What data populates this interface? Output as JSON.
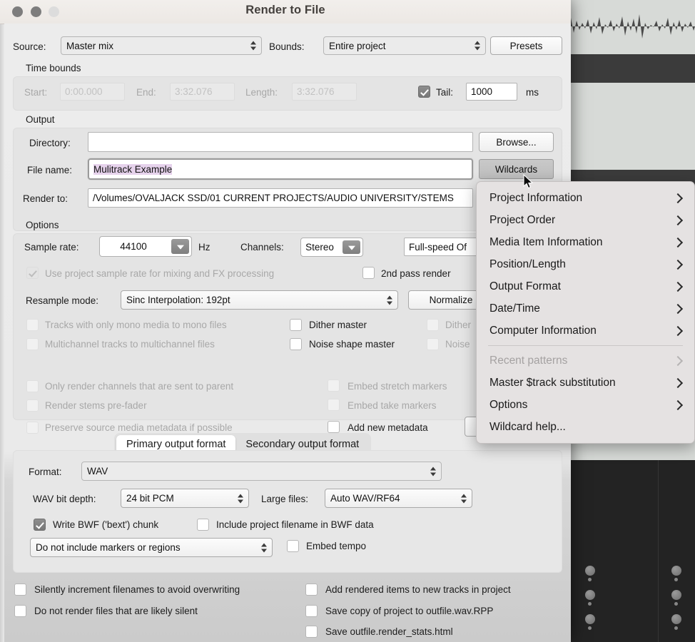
{
  "window": {
    "title": "Render to File",
    "traffic_lights": [
      "close",
      "minimize",
      "maximize"
    ]
  },
  "source_row": {
    "source_label": "Source:",
    "source_value": "Master mix",
    "bounds_label": "Bounds:",
    "bounds_value": "Entire project",
    "presets_button": "Presets"
  },
  "time_bounds": {
    "group_label": "Time bounds",
    "start_label": "Start:",
    "start_value": "0:00.000",
    "end_label": "End:",
    "end_value": "3:32.076",
    "length_label": "Length:",
    "length_value": "3:32.076",
    "tail_label": "Tail:",
    "tail_checked": true,
    "tail_value": "1000",
    "tail_units": "ms"
  },
  "output": {
    "group_label": "Output",
    "directory_label": "Directory:",
    "directory_value": "",
    "browse_button": "Browse...",
    "filename_label": "File name:",
    "filename_value": "Mulitrack Example",
    "wildcards_button": "Wildcards",
    "render_to_label": "Render to:",
    "render_to_value": "/Volumes/OVALJACK SSD/01 CURRENT PROJECTS/AUDIO UNIVERSITY/STEMS"
  },
  "options": {
    "group_label": "Options",
    "sample_rate_label": "Sample rate:",
    "sample_rate_value": "44100",
    "sample_rate_units": "Hz",
    "channels_label": "Channels:",
    "channels_value": "Stereo",
    "speed_value": "Full-speed Of",
    "resample_label": "Resample mode:",
    "resample_value": "Sinc Interpolation: 192pt",
    "normalize_button": "Normalize",
    "checkboxes": [
      {
        "label": "Use project sample rate for mixing and FX processing",
        "checked": true,
        "disabled": true
      },
      {
        "label": "2nd pass render",
        "checked": false,
        "disabled": false
      },
      {
        "label": "Tracks with only mono media to mono files",
        "checked": false,
        "disabled": true
      },
      {
        "label": "Dither master",
        "checked": false,
        "disabled": false
      },
      {
        "label": "Dither",
        "checked": false,
        "disabled": true
      },
      {
        "label": "Multichannel tracks to multichannel files",
        "checked": false,
        "disabled": true
      },
      {
        "label": "Noise shape master",
        "checked": false,
        "disabled": false
      },
      {
        "label": "Noise",
        "checked": false,
        "disabled": true
      },
      {
        "label": "Only render channels that are sent to parent",
        "checked": false,
        "disabled": true
      },
      {
        "label": "Embed stretch markers",
        "checked": false,
        "disabled": true
      },
      {
        "label": "Render stems pre-fader",
        "checked": false,
        "disabled": true
      },
      {
        "label": "Embed take markers",
        "checked": false,
        "disabled": true
      },
      {
        "label": "Preserve source media metadata if possible",
        "checked": false,
        "disabled": true
      },
      {
        "label": "Add new metadata",
        "checked": false,
        "disabled": false
      }
    ]
  },
  "format_tabs": {
    "primary": "Primary output format",
    "secondary": "Secondary output format",
    "active": "Primary output format"
  },
  "format_panel": {
    "format_label": "Format:",
    "format_value": "WAV",
    "bitdepth_label": "WAV bit depth:",
    "bitdepth_value": "24 bit PCM",
    "largefiles_label": "Large files:",
    "largefiles_value": "Auto WAV/RF64",
    "write_bwf_label": "Write BWF ('bext') chunk",
    "write_bwf_checked": true,
    "include_proj_label": "Include project filename in BWF data",
    "include_proj_checked": false,
    "markers_value": "Do not include markers or regions",
    "embed_tempo_label": "Embed tempo",
    "embed_tempo_checked": false
  },
  "footer": {
    "left": [
      {
        "label": "Silently increment filenames to avoid overwriting",
        "checked": false
      },
      {
        "label": "Do not render files that are likely silent",
        "checked": false
      }
    ],
    "right": [
      {
        "label": "Add rendered items to new tracks in project",
        "checked": false
      },
      {
        "label": "Save copy of project to outfile.wav.RPP",
        "checked": false
      },
      {
        "label": "Save outfile.render_stats.html",
        "checked": false
      }
    ]
  },
  "wildcard_menu": {
    "items": [
      {
        "label": "Project Information",
        "submenu": true,
        "disabled": false
      },
      {
        "label": "Project Order",
        "submenu": true,
        "disabled": false
      },
      {
        "label": "Media Item Information",
        "submenu": true,
        "disabled": false
      },
      {
        "label": "Position/Length",
        "submenu": true,
        "disabled": false
      },
      {
        "label": "Output Format",
        "submenu": true,
        "disabled": false
      },
      {
        "label": "Date/Time",
        "submenu": true,
        "disabled": false
      },
      {
        "label": "Computer Information",
        "submenu": true,
        "disabled": false
      },
      {
        "label": "Recent patterns",
        "submenu": true,
        "disabled": true
      },
      {
        "label": "Master $track substitution",
        "submenu": true,
        "disabled": false
      },
      {
        "label": "Options",
        "submenu": true,
        "disabled": false
      },
      {
        "label": "Wildcard help...",
        "submenu": false,
        "disabled": false
      }
    ]
  },
  "colors": {
    "dialog_bg": "#e8e8e8",
    "titlebar_bg": "#efebe8",
    "selection": "#e6d2ec",
    "menu_bg": "#e5e2e2",
    "accent_check": "#808080"
  }
}
